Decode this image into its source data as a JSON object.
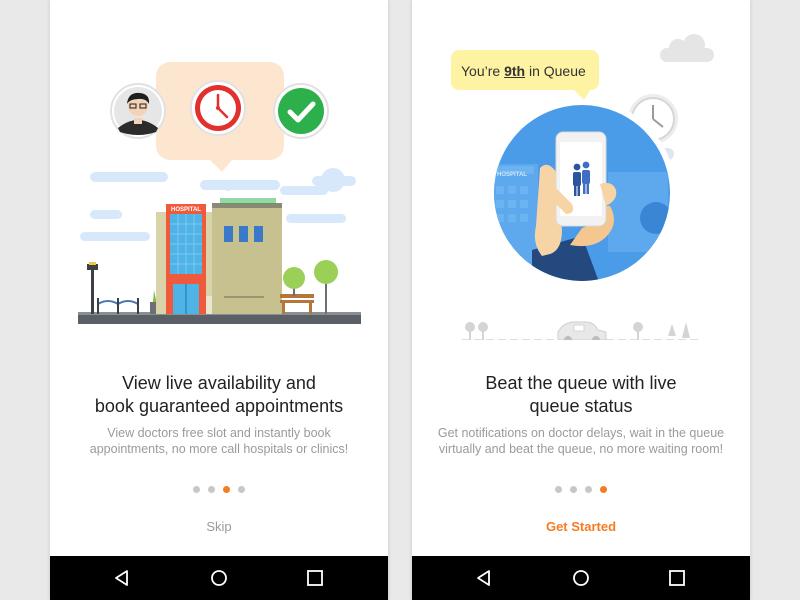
{
  "screens": [
    {
      "title": "View live availability and\nbook guaranteed appointments",
      "description": "View doctors free slot and instantly book\nappointments, no more call hospitals or clinics!",
      "pagination": {
        "total": 4,
        "active": 2
      },
      "action_label": "Skip",
      "illustration": {
        "hospital_sign": "HOSPITAL",
        "icons": [
          "doctor-avatar-icon",
          "clock-icon",
          "check-icon"
        ]
      }
    },
    {
      "title": "Beat the queue with live\nqueue status",
      "description": "Get notifications on doctor delays, wait in the queue\nvirtually and beat the queue, no more waiting room!",
      "pagination": {
        "total": 4,
        "active": 3
      },
      "action_label": "Get Started",
      "illustration": {
        "bubble_prefix": "You’re ",
        "bubble_highlight": "9th",
        "bubble_suffix": " in Queue",
        "hospital_sign": "HOSPITAL",
        "icons": [
          "phone-icon",
          "people-icon",
          "clock-icon",
          "car-icon"
        ]
      }
    }
  ],
  "navbar": {
    "icons": [
      "back-icon",
      "home-icon",
      "recent-apps-icon"
    ]
  },
  "colors": {
    "accent": "#f57c22",
    "dot_inactive": "#c7c7c7",
    "title": "#222222",
    "description": "#9a9a9a",
    "navbar": "#000000",
    "circle_blue": "#4a9be8",
    "bubble_yellow": "#fdf3a3",
    "check_green": "#2db04b",
    "clock_red": "#e2302f"
  }
}
